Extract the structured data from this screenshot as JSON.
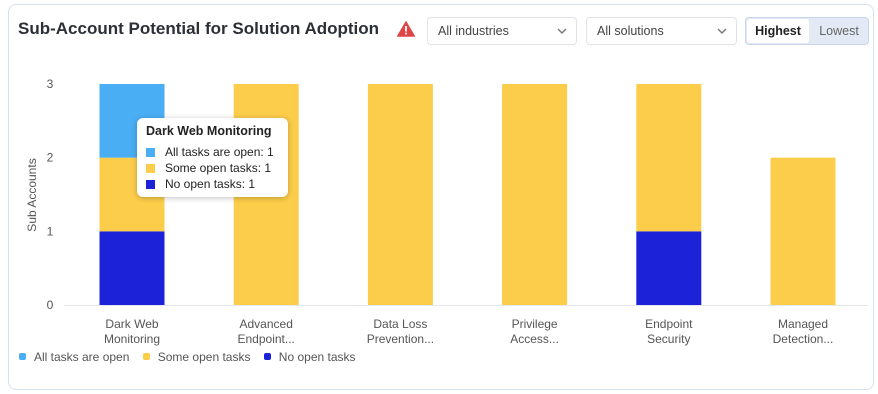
{
  "header": {
    "title": "Sub-Account Potential for Solution Adoption",
    "warning_icon": "warning-triangle-icon",
    "industry_select": "All industries",
    "solution_select": "All solutions",
    "sort_options": [
      "Highest",
      "Lowest"
    ],
    "sort_selected": "Highest"
  },
  "colors": {
    "all_open": "#4aaef4",
    "some_open": "#fccd4a",
    "none_open": "#1b22d8",
    "warning": "#e04545"
  },
  "tooltip": {
    "title": "Dark Web Monitoring",
    "rows": [
      "All tasks are open: 1",
      "Some open tasks: 1",
      "No open tasks: 1"
    ]
  },
  "legend": [
    "All tasks are open",
    "Some open tasks",
    "No open tasks"
  ],
  "chart_data": {
    "type": "bar",
    "stacked": true,
    "ylabel": "Sub Accounts",
    "ylim": [
      0,
      3
    ],
    "yticks": [
      0,
      1,
      2,
      3
    ],
    "grid": false,
    "legend_position": "bottom-left",
    "categories": [
      [
        "Dark Web",
        "Monitoring"
      ],
      [
        "Advanced",
        "Endpoint..."
      ],
      [
        "Data Loss",
        "Prevention..."
      ],
      [
        "Privilege",
        "Access..."
      ],
      [
        "Endpoint",
        "Security"
      ],
      [
        "Managed",
        "Detection..."
      ]
    ],
    "series": [
      {
        "name": "No open tasks",
        "values": [
          1,
          0,
          0,
          0,
          1,
          0
        ]
      },
      {
        "name": "Some open tasks",
        "values": [
          1,
          3,
          3,
          3,
          2,
          2
        ]
      },
      {
        "name": "All tasks are open",
        "values": [
          1,
          0,
          0,
          0,
          0,
          0
        ]
      }
    ]
  }
}
